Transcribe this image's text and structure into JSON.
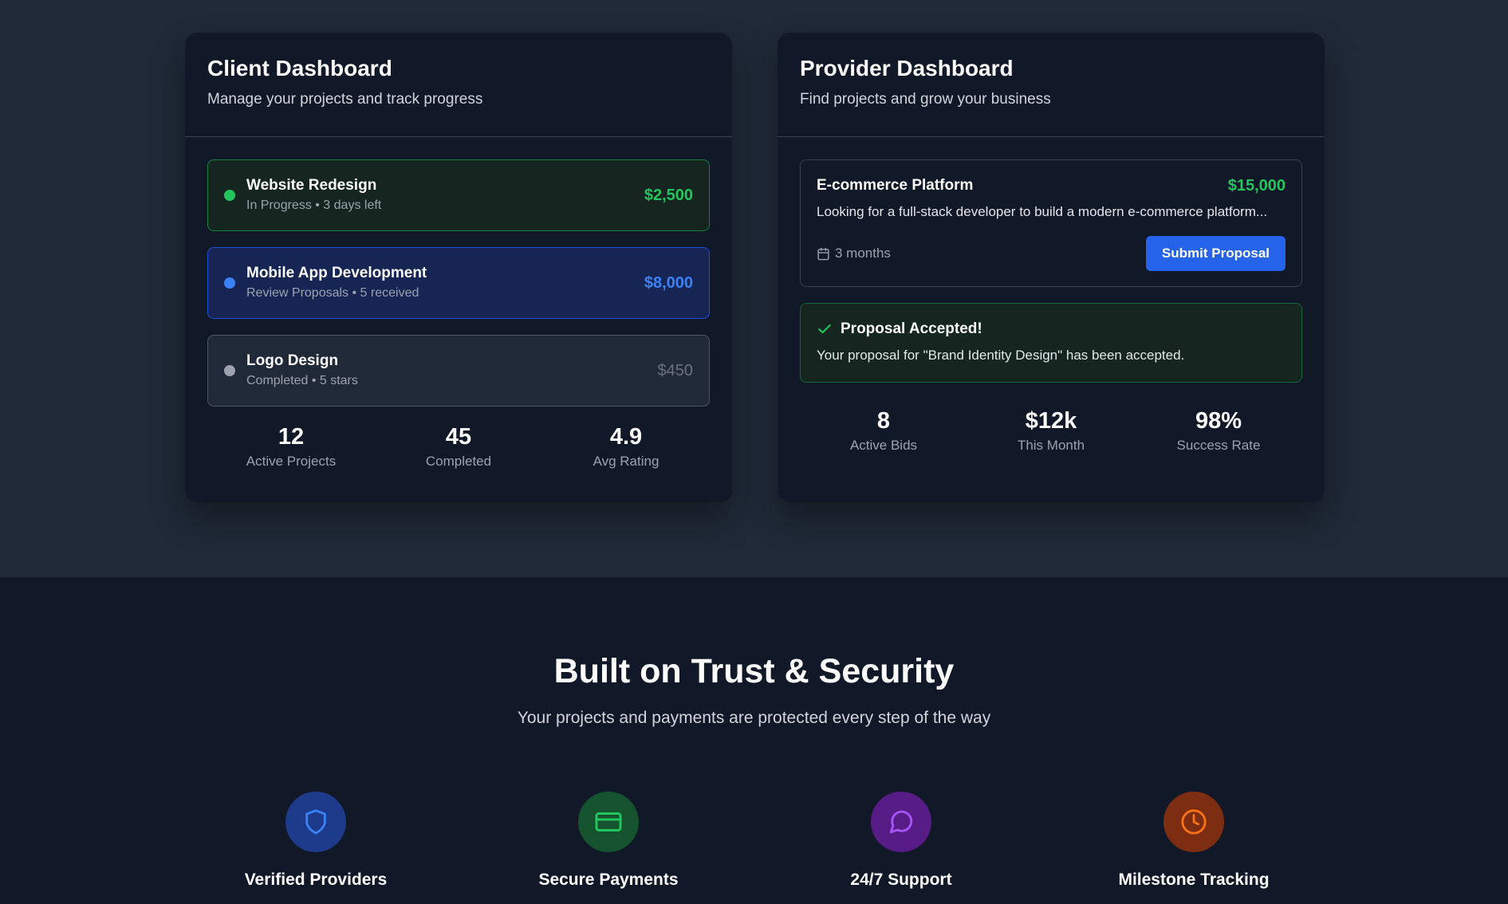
{
  "client": {
    "title": "Client Dashboard",
    "subtitle": "Manage your projects and track progress",
    "projects": [
      {
        "name": "Website Redesign",
        "meta": "In Progress • 3 days left",
        "price": "$2,500",
        "color": "#22c55e"
      },
      {
        "name": "Mobile App Development",
        "meta": "Review Proposals • 5 received",
        "price": "$8,000",
        "color": "#3b82f6"
      },
      {
        "name": "Logo Design",
        "meta": "Completed • 5 stars",
        "price": "$450",
        "color": "#9ca3af"
      }
    ],
    "stats": [
      {
        "value": "12",
        "label": "Active Projects"
      },
      {
        "value": "45",
        "label": "Completed"
      },
      {
        "value": "4.9",
        "label": "Avg Rating"
      }
    ]
  },
  "provider": {
    "title": "Provider Dashboard",
    "subtitle": "Find projects and grow your business",
    "job": {
      "title": "E-commerce Platform",
      "price": "$15,000",
      "description": "Looking for a full-stack developer to build a modern e-commerce platform...",
      "duration": "3 months",
      "submit_label": "Submit Proposal"
    },
    "notification": {
      "title": "Proposal Accepted!",
      "text": "Your proposal for \"Brand Identity Design\" has been accepted."
    },
    "stats": [
      {
        "value": "8",
        "label": "Active Bids"
      },
      {
        "value": "$12k",
        "label": "This Month"
      },
      {
        "value": "98%",
        "label": "Success Rate"
      }
    ]
  },
  "trust": {
    "title": "Built on Trust & Security",
    "subtitle": "Your projects and payments are protected every step of the way",
    "features": [
      {
        "label": "Verified Providers",
        "icon": "shield-icon",
        "bg": "#1e3a8a",
        "fg": "#3b82f6"
      },
      {
        "label": "Secure Payments",
        "icon": "credit-card-icon",
        "bg": "#14532d",
        "fg": "#22c55e"
      },
      {
        "label": "24/7 Support",
        "icon": "chat-bubble-icon",
        "bg": "#581c87",
        "fg": "#a855f7"
      },
      {
        "label": "Milestone Tracking",
        "icon": "clock-icon",
        "bg": "#7c2d12",
        "fg": "#f97316"
      }
    ]
  }
}
